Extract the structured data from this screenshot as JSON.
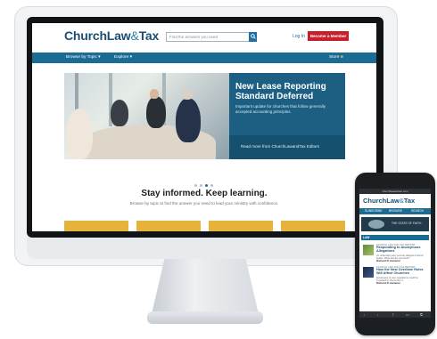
{
  "site": {
    "logo_main": "ChurchLaw",
    "logo_amp": "&",
    "logo_end": "Tax",
    "search_placeholder": "Find the answers you need",
    "signin": "Log In",
    "member_button": "Become a Member"
  },
  "nav": {
    "browse": "Browse by Topic ▾",
    "explore": "Explore ▾",
    "store": "Store"
  },
  "hero": {
    "title": "New Lease Reporting Standard Deferred",
    "subtitle": "Important update for churches that follow generally accepted accounting principles.",
    "link": "Read more from ChurchLawandTax Editors"
  },
  "tagline": {
    "heading": "Stay informed. Keep learning.",
    "sub": "Browse by topic to find the answer you need to lead your ministry with confidence."
  },
  "phone": {
    "url": "churchlawandtax.com",
    "logo_main": "ChurchLaw",
    "logo_amp": "&",
    "logo_end": "Tax",
    "nav": [
      "SUBSCRIBE",
      "BROWSE",
      "SEARCH"
    ],
    "banner": "THE STATE OF FAITH",
    "section": "LAW",
    "articles": [
      {
        "kicker": "CHURCH LAW AND TAX REPORT",
        "title": "Responding to Anonymous Allegations",
        "desc": "An unfamiliar party secretly alleged a church leader. What should you know?",
        "author": "Richard R. Hammar"
      },
      {
        "kicker": "CHURCH LAW AND TAX REPORT",
        "title": "How the New Overtime Rules Will Affect Churches",
        "desc": "Employees of new regulations could be impacted by December 1.",
        "author": "Richard R. Hammar"
      }
    ]
  },
  "colors": {
    "brand_blue": "#1b6c95",
    "logo_navy": "#1a4f73",
    "cta_red": "#c8202b",
    "card_gold": "#e6b33a"
  }
}
